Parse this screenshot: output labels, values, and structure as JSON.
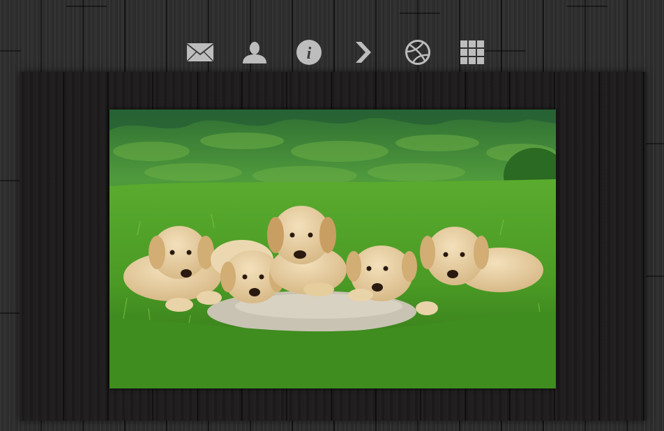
{
  "toolbar": {
    "items": [
      {
        "icon": "mail-icon"
      },
      {
        "icon": "user-icon"
      },
      {
        "icon": "info-icon",
        "glyph": "i"
      },
      {
        "icon": "chevron-right-icon"
      },
      {
        "icon": "dribbble-icon"
      },
      {
        "icon": "grid-icon"
      }
    ],
    "icon_color": "#bdbdbd"
  },
  "photo": {
    "subject": "puppies-on-grass",
    "colors": {
      "grass": "#4e9e2b",
      "grass_dark": "#2f6e1a",
      "forest": "#3c8a3a",
      "puppy": "#e8cfa0",
      "stone": "#c9c3b3"
    }
  }
}
